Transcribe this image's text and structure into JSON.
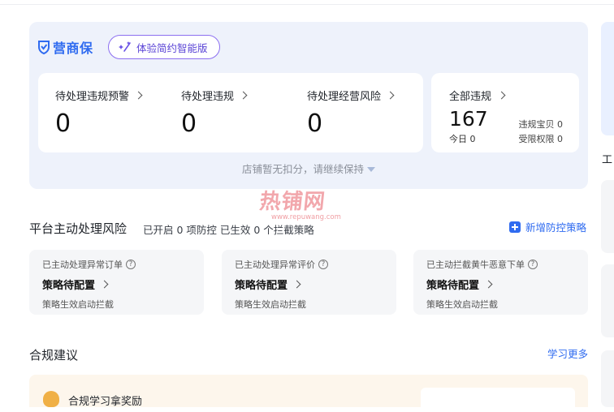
{
  "brand": {
    "name": "营商保",
    "color": "#2f6bf0"
  },
  "promo_button": {
    "label": "体验简约智能版",
    "icon": "sparkle-wand-icon"
  },
  "stats": [
    {
      "label": "待处理违规预警",
      "value": "0"
    },
    {
      "label": "待处理违规",
      "value": "0"
    },
    {
      "label": "待处理经营风险",
      "value": "0"
    }
  ],
  "all_violations": {
    "label": "全部违规",
    "value": "167",
    "today": "今日 0",
    "items": [
      "违规宝贝 0",
      "受限权限 0"
    ]
  },
  "hero_note": "店铺暂无扣分，请继续保持",
  "watermark": {
    "main": "热铺网",
    "sub": "www.repuwang.com"
  },
  "platform_risk": {
    "title": "平台主动处理风险",
    "subtitle": "已开启 0 项防控 已生效 0 个拦截策略",
    "add_label": "新增防控策略",
    "cards": [
      {
        "head": "已主动处理异常订单",
        "status": "策略待配置",
        "foot": "策略生效启动拦截"
      },
      {
        "head": "已主动处理异常评价",
        "status": "策略待配置",
        "foot": "策略生效启动拦截"
      },
      {
        "head": "已主动拦截黄牛恶意下单",
        "status": "策略待配置",
        "foot": "策略生效启动拦截"
      }
    ]
  },
  "compliance": {
    "title": "合规建议",
    "learn_more": "学习更多",
    "bottom_item": "合规学习拿奖励"
  },
  "right_column": {
    "partial_title": "工"
  }
}
